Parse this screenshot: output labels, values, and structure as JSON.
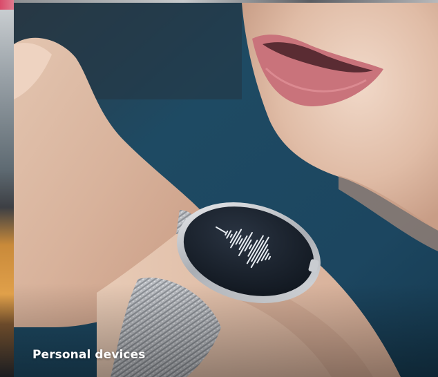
{
  "card": {
    "label": "Personal devices",
    "image_subject": "person speaking to a smartwatch showing a voice waveform"
  },
  "colors": {
    "background_blue": "#1f4a63",
    "skin": "#d9b79e",
    "watch_face": "#1a2330",
    "label_text": "#ffffff"
  }
}
